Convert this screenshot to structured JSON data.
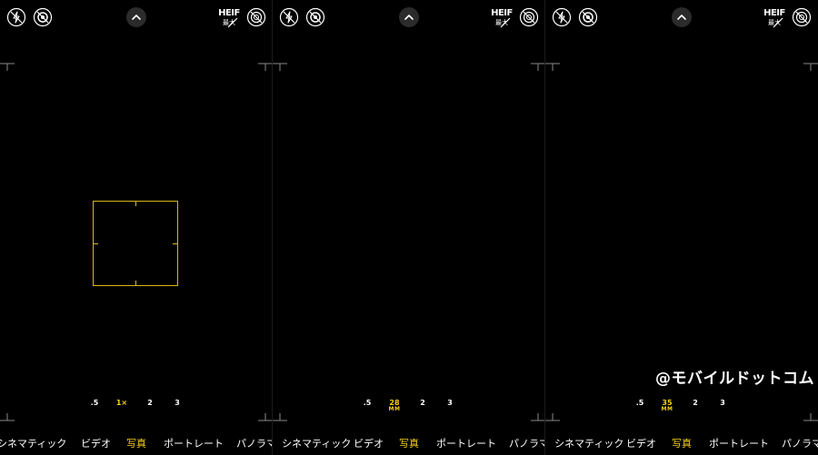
{
  "screens": [
    {
      "zoom_options": [
        {
          "label": ".5",
          "selected": false
        },
        {
          "label": "1×",
          "selected": true
        },
        {
          "label": "2",
          "selected": false
        },
        {
          "label": "3",
          "selected": false
        }
      ],
      "has_focus_box": true
    },
    {
      "zoom_options": [
        {
          "label": ".5",
          "selected": false
        },
        {
          "label": "28",
          "sub": "MM",
          "selected": true
        },
        {
          "label": "2",
          "selected": false
        },
        {
          "label": "3",
          "selected": false
        }
      ],
      "has_focus_box": false
    },
    {
      "zoom_options": [
        {
          "label": ".5",
          "selected": false
        },
        {
          "label": "35",
          "sub": "MM",
          "selected": true
        },
        {
          "label": "2",
          "selected": false
        },
        {
          "label": "3",
          "selected": false
        }
      ],
      "has_focus_box": false
    }
  ],
  "top_controls": {
    "heif_label": "HEIF",
    "heif_sub": "最大"
  },
  "modes": {
    "cinematic": "シネマティック",
    "video": "ビデオ",
    "photo": "写真",
    "portrait": "ポートレート",
    "panorama": "パノラマ",
    "active": "photo"
  },
  "watermark": "@モバイルドットコム",
  "colors": {
    "accent": "#f7d117",
    "focus": "#d9b517",
    "background": "#000000"
  },
  "icons": {
    "flash": "flash-off-icon",
    "live": "live-photo-off-icon",
    "chevron": "chevron-up-icon",
    "heif": "heif-max-off-icon",
    "styles": "photographic-styles-off-icon"
  }
}
